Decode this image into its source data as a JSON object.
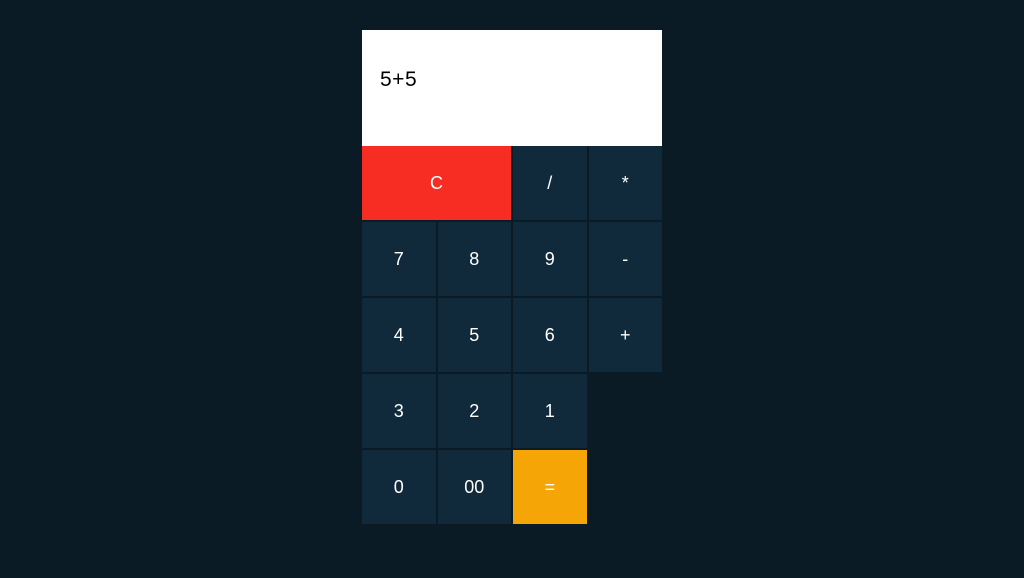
{
  "display": {
    "value": "5+5"
  },
  "keys": {
    "clear": "C",
    "divide": "/",
    "multiply": "*",
    "seven": "7",
    "eight": "8",
    "nine": "9",
    "minus": "-",
    "four": "4",
    "five": "5",
    "six": "6",
    "plus": "+",
    "three": "3",
    "two": "2",
    "one": "1",
    "zero": "0",
    "doublezero": "00",
    "equals": "="
  }
}
